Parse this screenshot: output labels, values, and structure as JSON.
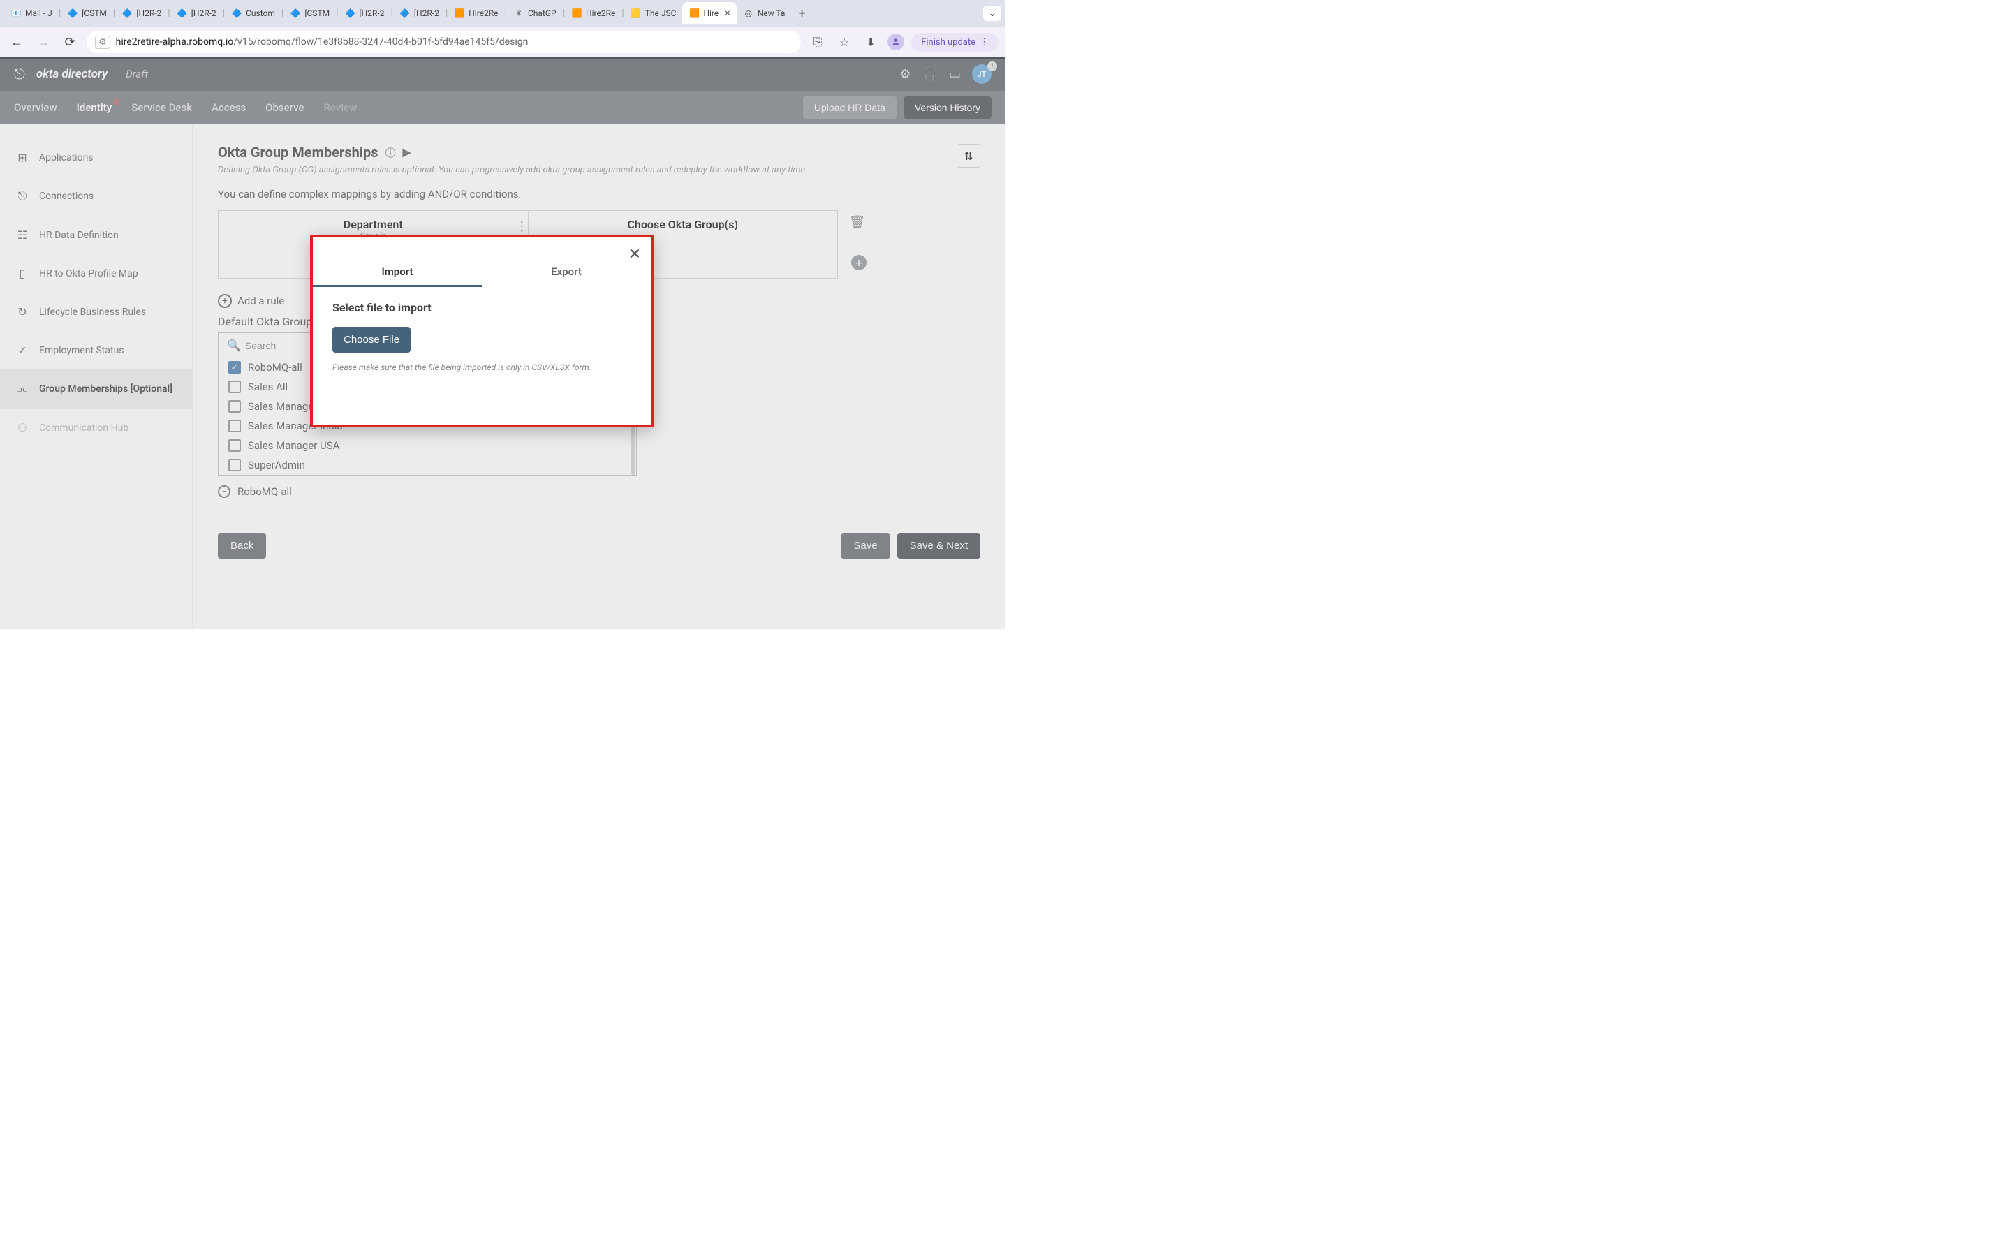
{
  "browser": {
    "tabs": [
      {
        "icon": "📧",
        "title": "Mail - J"
      },
      {
        "icon": "🔷",
        "title": "[CSTM"
      },
      {
        "icon": "🔷",
        "title": "[H2R-2"
      },
      {
        "icon": "🔷",
        "title": "[H2R-2"
      },
      {
        "icon": "🔷",
        "title": "Custom"
      },
      {
        "icon": "🔷",
        "title": "[CSTM"
      },
      {
        "icon": "🔷",
        "title": "[H2R-2"
      },
      {
        "icon": "🔷",
        "title": "[H2R-2"
      },
      {
        "icon": "🟧",
        "title": "Hire2Re"
      },
      {
        "icon": "✳",
        "title": "ChatGP"
      },
      {
        "icon": "🟧",
        "title": "Hire2Re"
      },
      {
        "icon": "🟨",
        "title": "The JSC"
      },
      {
        "icon": "🟧",
        "title": "Hire",
        "active": true
      },
      {
        "icon": "◎",
        "title": "New Ta"
      }
    ],
    "url_host": "hire2retire-alpha.robomq.io",
    "url_path": "/v15/robomq/flow/1e3f8b88-3247-40d4-b01f-5fd94ae145f5/design",
    "finish_label": "Finish update"
  },
  "header": {
    "title": "okta directory",
    "status": "Draft",
    "avatar": "JT"
  },
  "nav": {
    "items": [
      "Overview",
      "Identity",
      "Service Desk",
      "Access",
      "Observe",
      "Review"
    ],
    "upload": "Upload HR Data",
    "version": "Version History"
  },
  "sidebar": {
    "items": [
      {
        "icon": "⊞",
        "label": "Applications"
      },
      {
        "icon": "⎋",
        "label": "Connections"
      },
      {
        "icon": "☷",
        "label": "HR Data Definition"
      },
      {
        "icon": "▯",
        "label": "HR to Okta Profile Map"
      },
      {
        "icon": "↻",
        "label": "Lifecycle Business Rules"
      },
      {
        "icon": "✓",
        "label": "Employment Status"
      },
      {
        "icon": "⫘",
        "label": "Group Memberships [Optional]",
        "active": true
      },
      {
        "icon": "⚇",
        "label": "Communication Hub",
        "dim": true
      }
    ]
  },
  "main": {
    "title": "Okta Group Memberships",
    "subtitle": "Defining Okta Group (OG) assignments rules is optional. You can progressively add okta group assignment rules and redeploy the workflow at any time.",
    "desc": "You can define complex mappings by adding AND/OR conditions.",
    "rule_col1": "Department",
    "rule_col1_sub": "Equals",
    "rule_col2": "Choose Okta Group(s)",
    "add_rule": "Add a rule",
    "default_label": "Default Okta Group(s)",
    "search_placeholder": "Search",
    "groups": [
      {
        "label": "RoboMQ-all",
        "checked": true
      },
      {
        "label": "Sales All",
        "checked": false
      },
      {
        "label": "Sales Manager",
        "checked": false
      },
      {
        "label": "Sales Manager India",
        "checked": false
      },
      {
        "label": "Sales Manager USA",
        "checked": false
      },
      {
        "label": "SuperAdmin",
        "checked": false
      }
    ],
    "chip": "RoboMQ-all",
    "back": "Back",
    "save": "Save",
    "save_next": "Save & Next"
  },
  "modal": {
    "tab_import": "Import",
    "tab_export": "Export",
    "heading": "Select file to import",
    "choose": "Choose File",
    "hint": "Please make sure that the file being imported is only in CSV/XLSX form."
  }
}
